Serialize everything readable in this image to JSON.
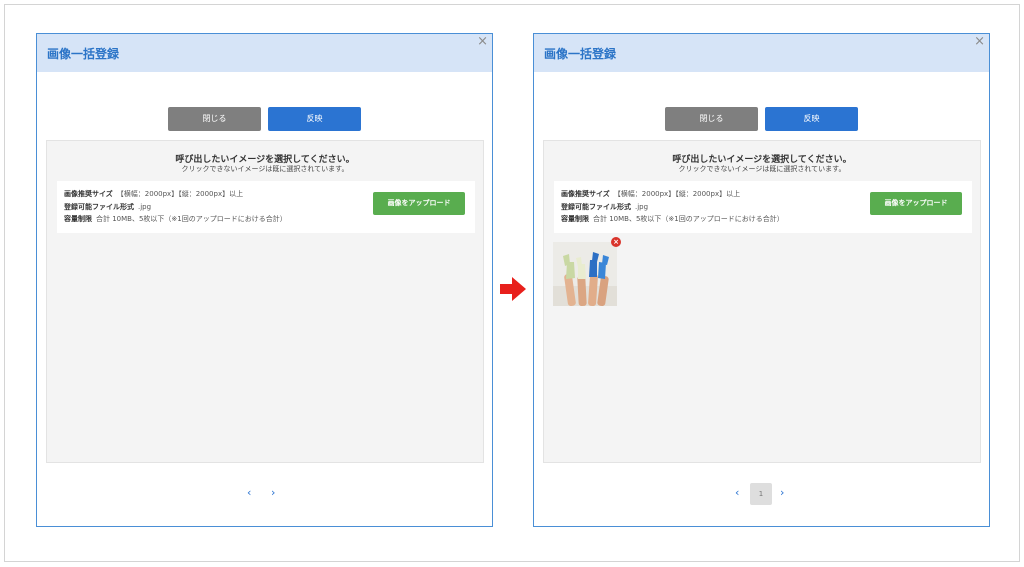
{
  "dialog": {
    "title": "画像一括登録",
    "close_glyph": "×",
    "close_button": "閉じる",
    "apply_button": "反映",
    "heading": "呼び出したいイメージを選択してください。",
    "subheading": "クリックできないイメージは既に選択されています。",
    "info": {
      "size_label": "画像推奨サイズ",
      "size_value": "【横幅：2000px】【縦：2000px】以上",
      "format_label": "登録可能ファイル形式",
      "format_value": ".jpg",
      "limit_label": "容量制限",
      "limit_value": "合計 10MB、5枚以下（※1回のアップロードにおける合計）"
    },
    "upload_button": "画像をアップロード",
    "pager_prev": "‹",
    "pager_next": "›",
    "current_page": "1",
    "remove_glyph": "×"
  },
  "colors": {
    "accent": "#2b74d2",
    "header_bg": "#d6e4f7",
    "upload_green": "#59ad4f",
    "arrow_red": "#e8201c"
  },
  "icons": {
    "arrow": "right-arrow-icon",
    "close": "close-icon",
    "remove": "remove-icon"
  }
}
